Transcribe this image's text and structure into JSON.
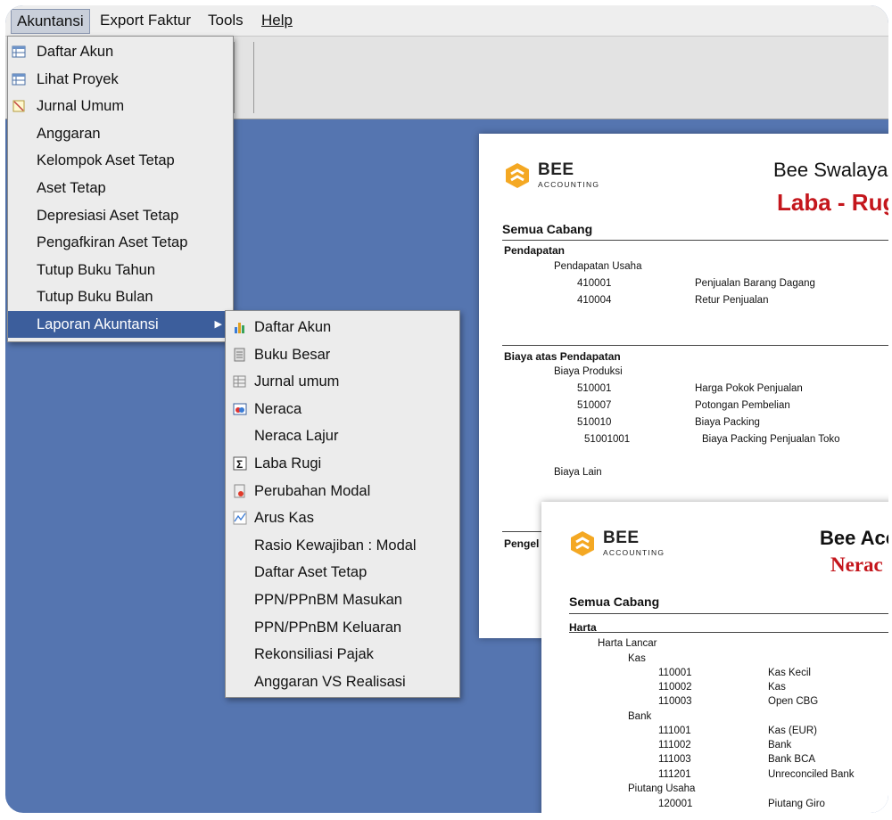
{
  "menubar": [
    "Akuntansi",
    "Export Faktur",
    "Tools",
    "Help"
  ],
  "akuntansi_menu": [
    {
      "label": "Daftar Akun",
      "icon": "table-icon"
    },
    {
      "label": "Lihat Proyek",
      "icon": "table-icon"
    },
    {
      "label": "Jurnal Umum",
      "icon": "journal-icon"
    },
    {
      "label": "Anggaran",
      "icon": ""
    },
    {
      "label": "Kelompok Aset Tetap",
      "icon": ""
    },
    {
      "label": "Aset Tetap",
      "icon": ""
    },
    {
      "label": "Depresiasi Aset Tetap",
      "icon": ""
    },
    {
      "label": "Pengafkiran Aset Tetap",
      "icon": ""
    },
    {
      "label": "Tutup Buku Tahun",
      "icon": ""
    },
    {
      "label": "Tutup Buku Bulan",
      "icon": ""
    },
    {
      "label": "Laporan Akuntansi",
      "icon": "",
      "submenu": true
    }
  ],
  "laporan_menu": [
    {
      "label": "Daftar Akun",
      "icon": "bar-chart-icon"
    },
    {
      "label": "Buku Besar",
      "icon": "ledger-icon"
    },
    {
      "label": "Jurnal umum",
      "icon": "journal-grid-icon"
    },
    {
      "label": "Neraca",
      "icon": "balance-icon"
    },
    {
      "label": "Neraca Lajur",
      "icon": ""
    },
    {
      "label": "Laba Rugi",
      "icon": "sigma-icon"
    },
    {
      "label": "Perubahan Modal",
      "icon": "equity-icon"
    },
    {
      "label": "Arus Kas",
      "icon": "line-chart-icon"
    },
    {
      "label": "Rasio Kewajiban : Modal",
      "icon": ""
    },
    {
      "label": "Daftar Aset Tetap",
      "icon": ""
    },
    {
      "label": "PPN/PPnBM Masukan",
      "icon": ""
    },
    {
      "label": "PPN/PPnBM Keluaran",
      "icon": ""
    },
    {
      "label": "Rekonsiliasi Pajak",
      "icon": ""
    },
    {
      "label": "Anggaran VS Realisasi",
      "icon": ""
    }
  ],
  "report1": {
    "logo_name": "BEE",
    "logo_sub": "ACCOUNTING",
    "company": "Bee Swalaya",
    "title": "Laba - Rug",
    "cabang": "Semua  Cabang",
    "lines": [
      {
        "text": "Pendapatan",
        "bold": true,
        "indent": 0
      },
      {
        "text": "Pendapatan Usaha",
        "indent": 1
      },
      {
        "code": "410001",
        "desc": "Penjualan Barang Dagang"
      },
      {
        "code": "410004",
        "desc": "Retur Penjualan"
      },
      {
        "text": "Biaya atas Pendapatan",
        "bold": true,
        "indent": 0
      },
      {
        "text": "Biaya Produksi",
        "indent": 1
      },
      {
        "code": "510001",
        "desc": "Harga Pokok Penjualan"
      },
      {
        "code": "510007",
        "desc": "Potongan Pembelian"
      },
      {
        "code": "510010",
        "desc": "Biaya Packing"
      },
      {
        "code": "51001001",
        "desc": "Biaya Packing Penjualan Toko",
        "sub": true
      },
      {
        "text": "Biaya Lain",
        "indent": 1
      },
      {
        "text": "Pengel",
        "bold": true,
        "indent": 0
      }
    ]
  },
  "report2": {
    "logo_name": "BEE",
    "logo_sub": "ACCOUNTING",
    "company": "Bee Acc",
    "title": "Nerac",
    "cabang": "Semua  Cabang",
    "lines": [
      {
        "text": "Harta",
        "bold": true,
        "indent": 0
      },
      {
        "text": "Harta Lancar",
        "indent": 1
      },
      {
        "text": "Kas",
        "indent": 2
      },
      {
        "code": "110001",
        "desc": "Kas Kecil"
      },
      {
        "code": "110002",
        "desc": "Kas"
      },
      {
        "code": "110003",
        "desc": "Open CBG"
      },
      {
        "text": "Bank",
        "indent": 2
      },
      {
        "code": "111001",
        "desc": "Kas (EUR)"
      },
      {
        "code": "111002",
        "desc": "Bank"
      },
      {
        "code": "111003",
        "desc": "Bank BCA"
      },
      {
        "code": "111201",
        "desc": "Unreconciled Bank"
      },
      {
        "text": "Piutang Usaha",
        "indent": 2
      },
      {
        "code": "120001",
        "desc": "Piutang Giro"
      }
    ]
  },
  "colors": {
    "desktop": "#5575b0",
    "selection": "#3c5e9c",
    "title_red": "#c4161c",
    "logo_orange": "#f4a823"
  }
}
